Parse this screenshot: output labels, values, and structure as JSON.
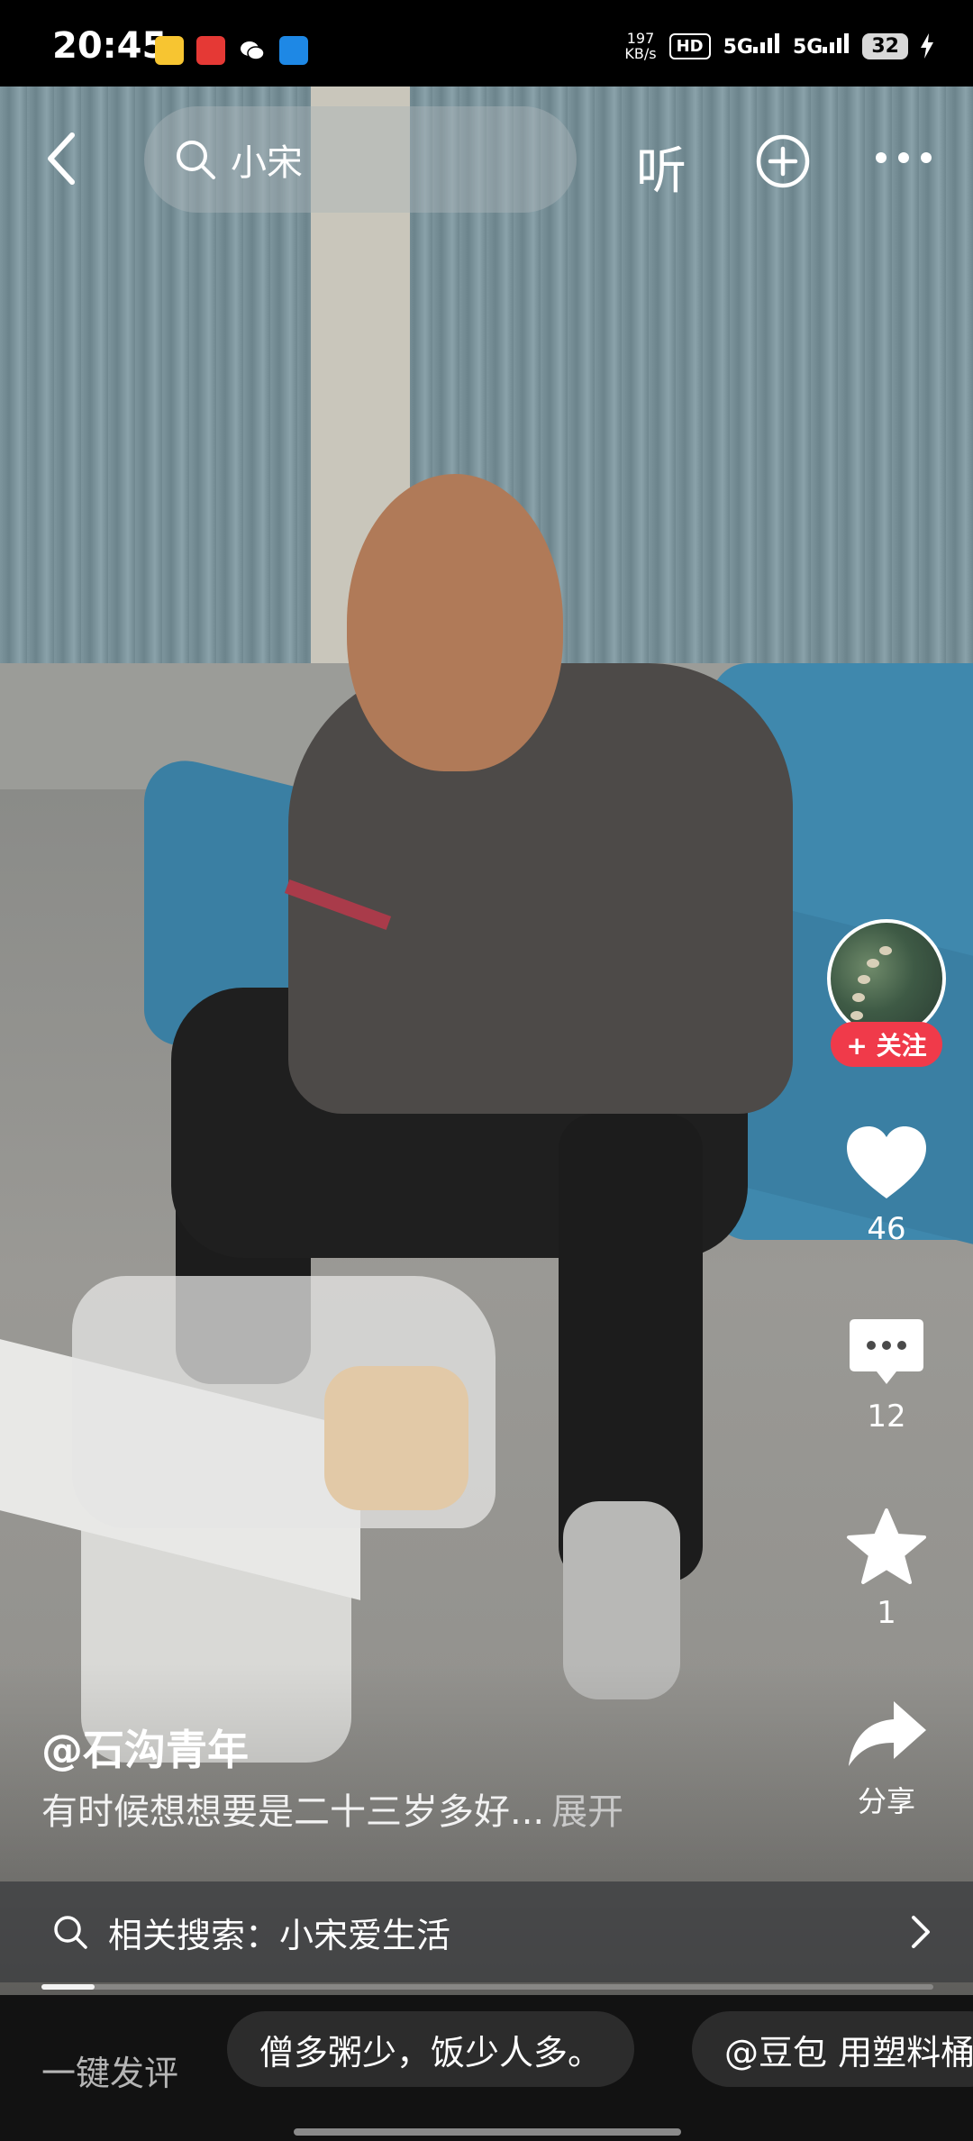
{
  "status_bar": {
    "time": "20:45",
    "speed_value": "197",
    "speed_unit": "KB/s",
    "hd_label": "HD",
    "signal1": "5G",
    "signal2": "5G",
    "battery": "32",
    "app_icons": [
      "meituan-icon",
      "toutiao-icon",
      "wechat-icon",
      "app-icon"
    ]
  },
  "top_bar": {
    "search_text": "小宋",
    "listen_label": "听"
  },
  "creator": {
    "follow_label": "+ 关注"
  },
  "actions": {
    "like_count": "46",
    "comment_count": "12",
    "favorite_count": "1",
    "share_label": "分享"
  },
  "caption": {
    "author": "@石沟青年",
    "description": "有时候想想要是二十三岁多好...",
    "expand_label": "展开"
  },
  "related_search": {
    "label": "相关搜索：",
    "value": "小宋爱生活"
  },
  "playback": {
    "progress": 0.06
  },
  "bottom_bar": {
    "quick_comment_label": "一键发评",
    "chips": [
      "僧多粥少，饭少人多。",
      "@豆包 用塑料桶"
    ]
  }
}
